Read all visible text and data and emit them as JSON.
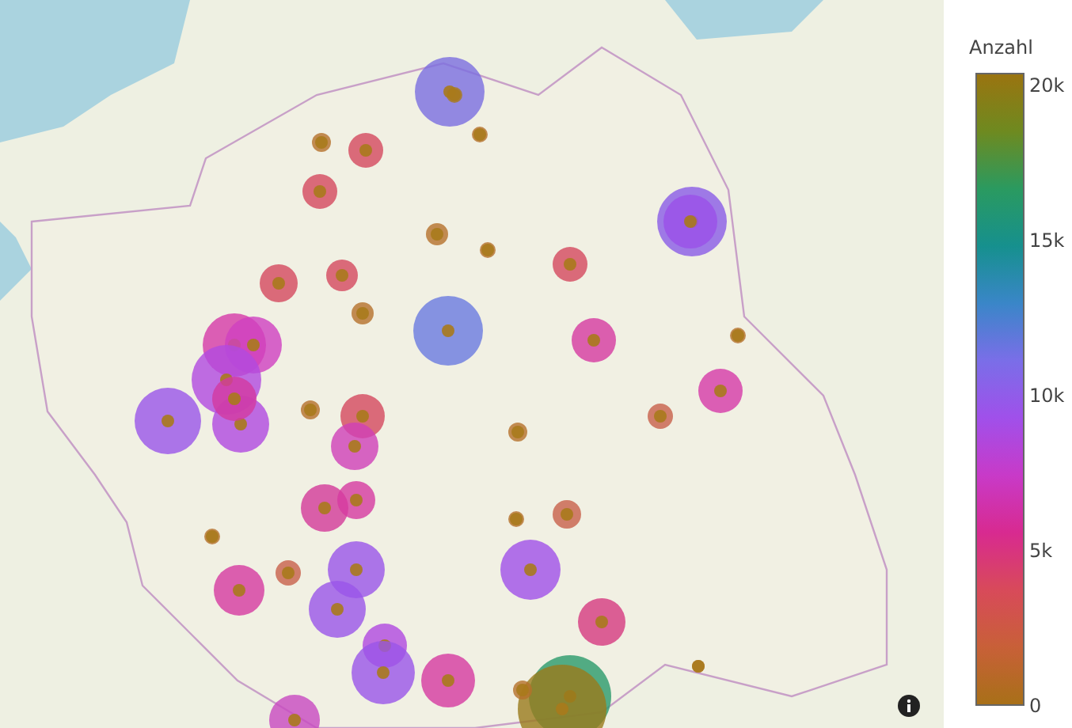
{
  "colorbar": {
    "title": "Anzahl",
    "ticks": [
      "20k",
      "15k",
      "10k",
      "5k",
      "0"
    ]
  }
}
